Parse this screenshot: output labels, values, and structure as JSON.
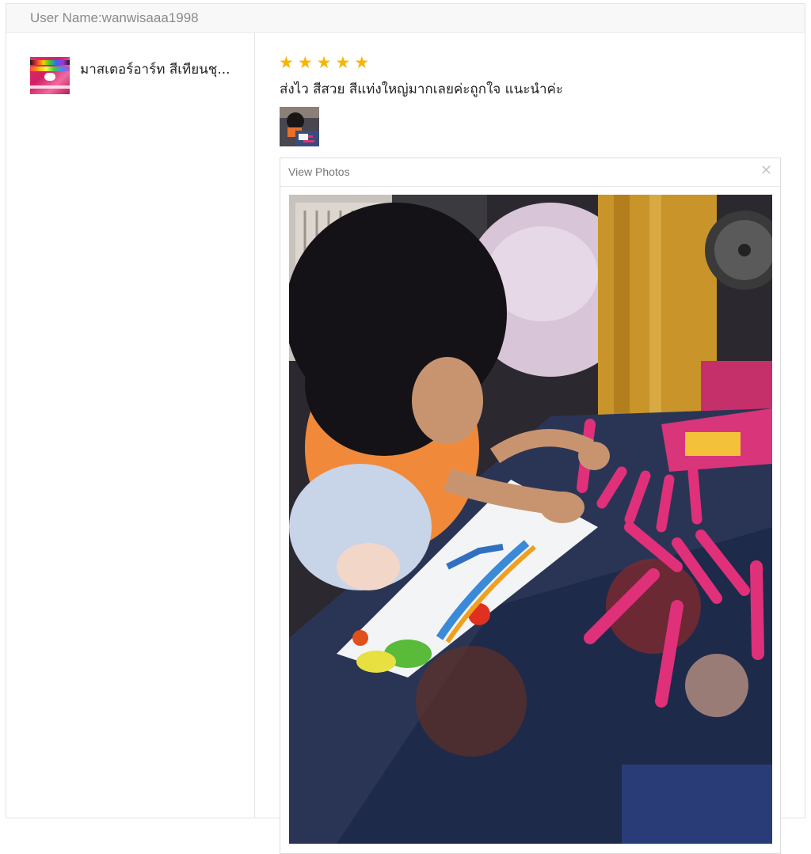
{
  "header": {
    "user_label": "User Name:wanwisaaa1998"
  },
  "product": {
    "title": "มาสเตอร์อาร์ท สีเทียนชุ...",
    "thumb_icon": "product-box-image"
  },
  "review": {
    "rating": 5,
    "rating_max": 5,
    "star_color": "#f7b500",
    "text": "ส่งไว สีสวย สีแท่งใหญ่มากเลยค่ะถูกใจ แนะนำค่ะ"
  },
  "viewer": {
    "title": "View Photos",
    "close_icon": "close-icon"
  }
}
